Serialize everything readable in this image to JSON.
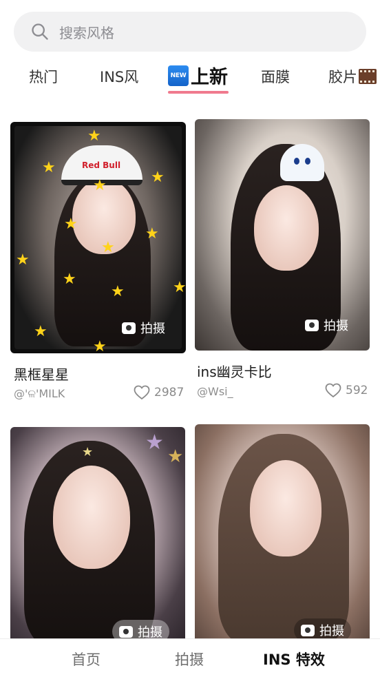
{
  "search": {
    "placeholder": "搜索风格"
  },
  "tabs": [
    {
      "label": "热门"
    },
    {
      "label": "INS风"
    },
    {
      "label": "上新",
      "badge": "NEW",
      "active": true
    },
    {
      "label": "面膜"
    },
    {
      "label": "胶片",
      "icon": "film-icon"
    }
  ],
  "cards": [
    {
      "title": "黑框星星",
      "author": "@'ଳ'MILK",
      "likes": "2987",
      "action": "拍摄"
    },
    {
      "title": "ins幽灵卡比",
      "author": "@Wsi_",
      "likes": "592",
      "action": "拍摄"
    },
    {
      "action": "拍摄"
    },
    {
      "action": "拍摄"
    }
  ],
  "cap_logo": "Red Bull",
  "bottom_nav": [
    {
      "label": "首页"
    },
    {
      "label": "拍摄"
    },
    {
      "label": "INS 特效",
      "active": true
    }
  ],
  "colors": {
    "accent_underline": "#f07a8e",
    "new_badge": "#1f76de"
  }
}
